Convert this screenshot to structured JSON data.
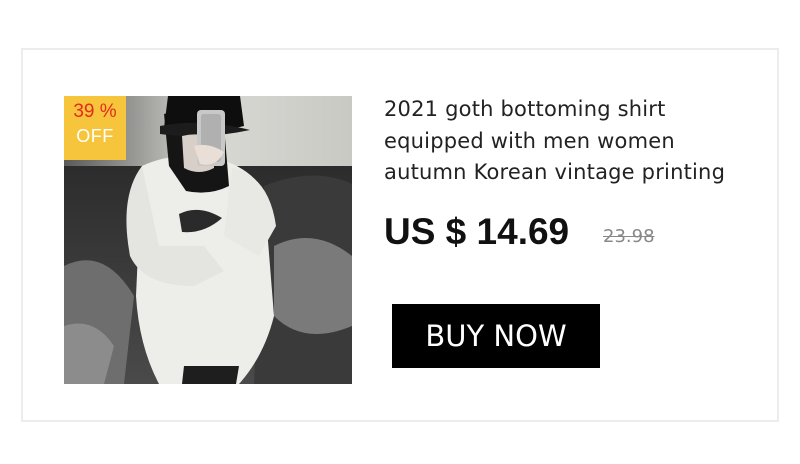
{
  "product": {
    "image_icon": "product-photo",
    "discount": {
      "percent": "39 %",
      "off_label": "OFF"
    },
    "title": "2021 goth bottoming shirt equipped with men women autumn Korean vintage printing",
    "price": "US $ 14.69",
    "original_price": "23.98"
  },
  "actions": {
    "buy_label": "BUY NOW"
  },
  "colors": {
    "badge_bg": "#f6c53c",
    "badge_text": "#e62b1e",
    "button_bg": "#000000",
    "button_text": "#ffffff"
  }
}
